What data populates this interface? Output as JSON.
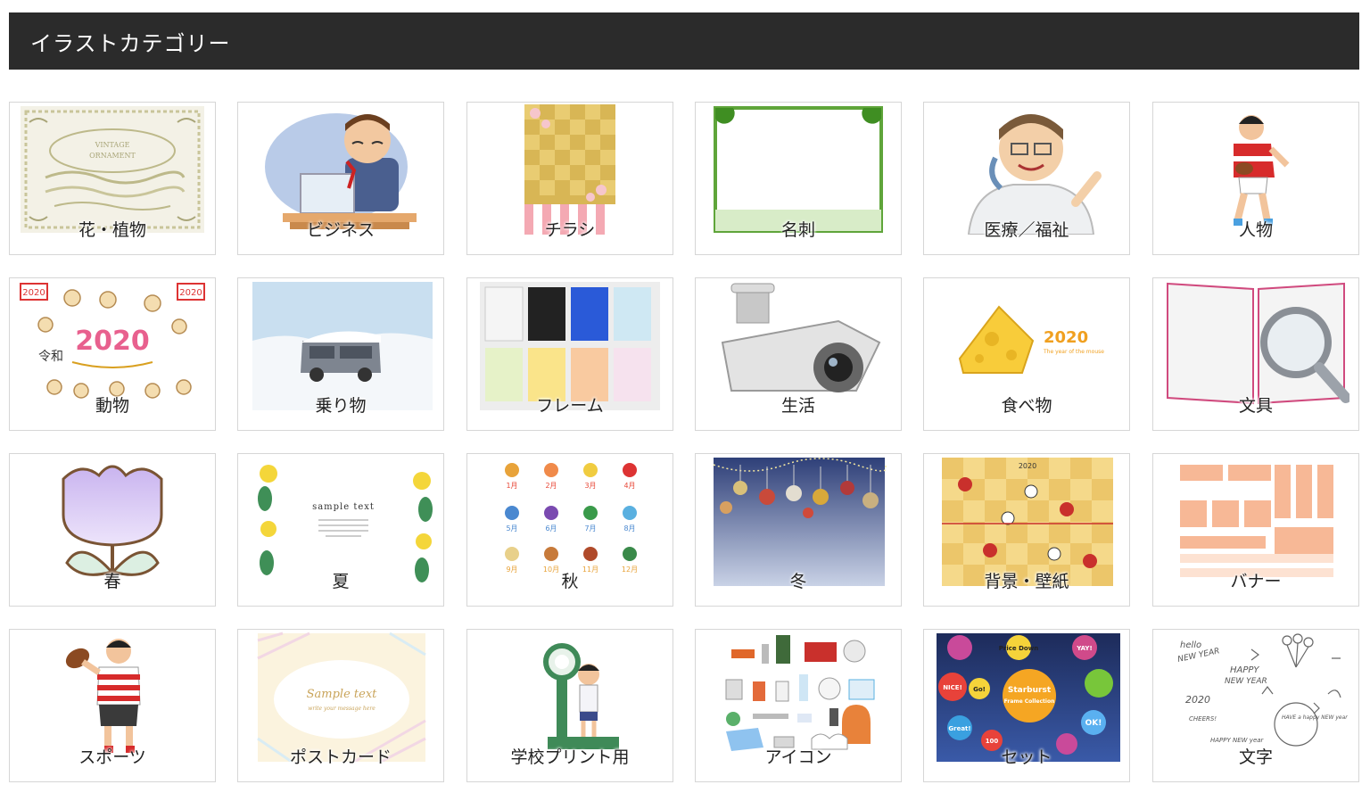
{
  "header": {
    "title": "イラストカテゴリー"
  },
  "categories": [
    {
      "label": "花・植物",
      "icon": "flower-ornament-icon"
    },
    {
      "label": "ビジネス",
      "icon": "businessman-icon"
    },
    {
      "label": "チラシ",
      "icon": "flyer-sakura-icon"
    },
    {
      "label": "名刺",
      "icon": "business-card-frame-icon"
    },
    {
      "label": "医療／福祉",
      "icon": "doctor-icon"
    },
    {
      "label": "人物",
      "icon": "rugby-player-icon"
    },
    {
      "label": "動物",
      "icon": "mouse-new-year-icon"
    },
    {
      "label": "乗り物",
      "icon": "snow-car-icon"
    },
    {
      "label": "フレーム",
      "icon": "frame-cards-icon"
    },
    {
      "label": "生活",
      "icon": "security-camera-icon"
    },
    {
      "label": "食べ物",
      "icon": "cheese-icon"
    },
    {
      "label": "文具",
      "icon": "book-magnifier-icon"
    },
    {
      "label": "春",
      "icon": "tulip-icon"
    },
    {
      "label": "夏",
      "icon": "summer-frame-icon"
    },
    {
      "label": "秋",
      "icon": "monthly-icons-icon"
    },
    {
      "label": "冬",
      "icon": "winter-ornaments-icon"
    },
    {
      "label": "背景・壁紙",
      "icon": "new-year-pattern-icon"
    },
    {
      "label": "バナー",
      "icon": "banner-set-icon"
    },
    {
      "label": "スポーツ",
      "icon": "football-boy-icon"
    },
    {
      "label": "ポストカード",
      "icon": "postcard-frame-icon"
    },
    {
      "label": "学校プリント用",
      "icon": "scale-boy-icon"
    },
    {
      "label": "アイコン",
      "icon": "camping-goods-icon"
    },
    {
      "label": "セット",
      "icon": "starburst-set-icon"
    },
    {
      "label": "文字",
      "icon": "handwritten-letters-icon"
    }
  ],
  "thumb_text": {
    "ornament": [
      "VINTAGE",
      "ORNAMENT"
    ],
    "year": "2020",
    "year_tag": "The year of the mouse",
    "reiwa": "令和",
    "sample": "sample text",
    "postcard_main": "Sample text",
    "postcard_sub": "write your message here",
    "stars": [
      "Price Down",
      "YAY!",
      "NICE!",
      "Go!",
      "Starburst",
      "Frame Collection",
      "Great!",
      "OK!",
      "100"
    ],
    "months": [
      "1月",
      "2月",
      "3月",
      "4月",
      "5月",
      "6月",
      "7月",
      "8月",
      "9月",
      "10月",
      "11月",
      "12月"
    ],
    "letters": [
      "hello",
      "NEW YEAR",
      "HAPPY",
      "NEW YEAR",
      "2020",
      "CHEERS!",
      "HAPPY NEW year",
      "HAVE a happy NEW year"
    ]
  }
}
